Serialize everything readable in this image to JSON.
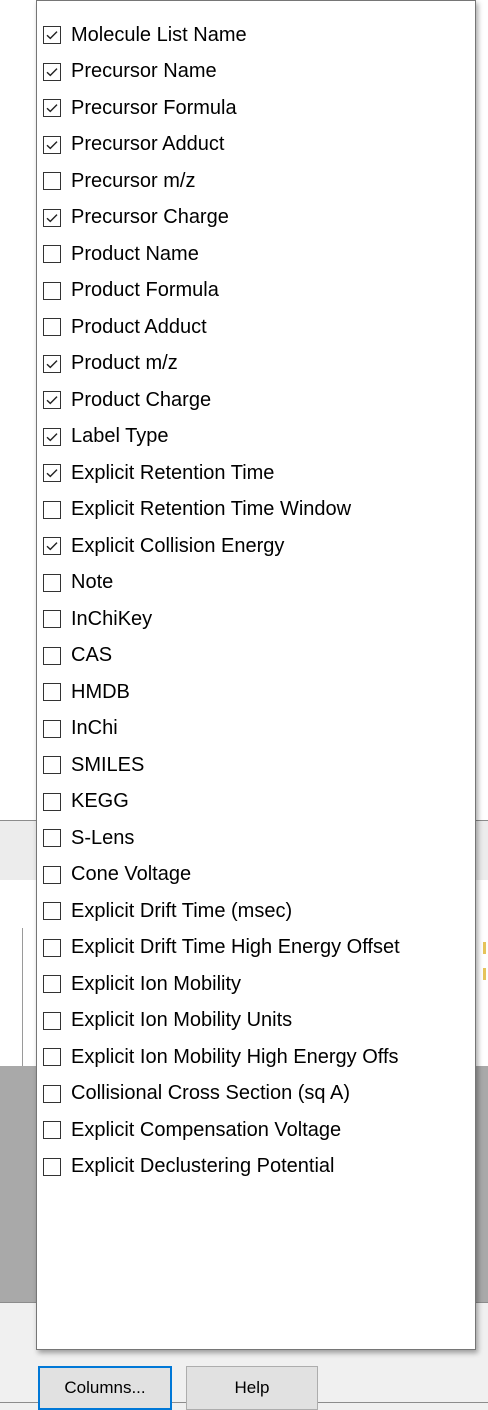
{
  "column_menu": {
    "items": [
      {
        "label": "Molecule List Name",
        "checked": true
      },
      {
        "label": "Precursor Name",
        "checked": true
      },
      {
        "label": "Precursor Formula",
        "checked": true
      },
      {
        "label": "Precursor Adduct",
        "checked": true
      },
      {
        "label": "Precursor m/z",
        "checked": false
      },
      {
        "label": "Precursor Charge",
        "checked": true
      },
      {
        "label": "Product Name",
        "checked": false
      },
      {
        "label": "Product Formula",
        "checked": false
      },
      {
        "label": "Product Adduct",
        "checked": false
      },
      {
        "label": "Product m/z",
        "checked": true
      },
      {
        "label": "Product Charge",
        "checked": true
      },
      {
        "label": "Label Type",
        "checked": true
      },
      {
        "label": "Explicit Retention Time",
        "checked": true
      },
      {
        "label": "Explicit Retention Time Window",
        "checked": false
      },
      {
        "label": "Explicit Collision Energy",
        "checked": true
      },
      {
        "label": "Note",
        "checked": false
      },
      {
        "label": "InChiKey",
        "checked": false
      },
      {
        "label": "CAS",
        "checked": false
      },
      {
        "label": "HMDB",
        "checked": false
      },
      {
        "label": "InChi",
        "checked": false
      },
      {
        "label": "SMILES",
        "checked": false
      },
      {
        "label": "KEGG",
        "checked": false
      },
      {
        "label": "S-Lens",
        "checked": false
      },
      {
        "label": "Cone Voltage",
        "checked": false
      },
      {
        "label": "Explicit Drift Time (msec)",
        "checked": false
      },
      {
        "label": "Explicit Drift Time High Energy Offset",
        "checked": false
      },
      {
        "label": "Explicit Ion Mobility",
        "checked": false
      },
      {
        "label": "Explicit Ion Mobility Units",
        "checked": false
      },
      {
        "label": "Explicit Ion Mobility High Energy Offs",
        "checked": false
      },
      {
        "label": "Collisional Cross Section (sq A)",
        "checked": false
      },
      {
        "label": "Explicit Compensation Voltage",
        "checked": false
      },
      {
        "label": "Explicit Declustering Potential",
        "checked": false
      }
    ]
  },
  "buttons": {
    "columns_label": "Columns...",
    "help_label": "Help"
  },
  "icons": {
    "checkbox_checked": "checkbox-checked-icon",
    "checkbox_unchecked": "checkbox-unchecked-icon"
  },
  "colors": {
    "focus_border": "#0078d7",
    "button_face": "#e1e1e1",
    "gray_area": "#a9a9a9",
    "dialog_bg": "#f0f0f0"
  }
}
